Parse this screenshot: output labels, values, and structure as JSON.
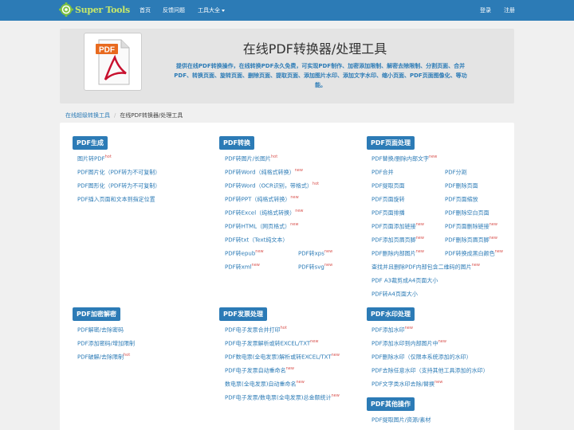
{
  "navbar": {
    "logo_text": "Super Tools",
    "items": [
      "首页",
      "反馈问题",
      "工具大全"
    ],
    "login": "登录",
    "register": "注册",
    "brand_color": "#2c7bb6"
  },
  "hero": {
    "title": "在线PDF转换器/处理工具",
    "desc_line1": "提供在线PDF转换操作，在线转换PDF永久免费，可实现PDF制作、加密添加限制、解密去除限制、分割页面、合并",
    "desc_line2": "PDF、转换页面、旋转页面、删除页面、提取页面、添加图片水印、添加文字水印、缩小页面、PDF页面图像化、等功",
    "desc_line3": "能。",
    "logo_text": "PDF"
  },
  "breadcrumb": {
    "parent": "在线超级转换工具",
    "current": "在线PDF转换器/处理工具"
  },
  "sections": {
    "s1": {
      "title": "PDF生成",
      "links": [
        {
          "t": "图片转PDF",
          "b": "hot"
        },
        {
          "t": "PDF图片化（PDF转为不可复制）",
          "b": ""
        },
        {
          "t": "PDF图形化（PDF转为不可复制）",
          "b": ""
        },
        {
          "t": "PDF插入页面和文本到指定位置",
          "b": ""
        }
      ]
    },
    "s2": {
      "title": "PDF转换",
      "links": [
        {
          "t": "PDF转图片/长图片",
          "b": "hot"
        },
        {
          "t": "PDF转Word（纯格式转换）",
          "b": "new"
        },
        {
          "t": "PDF转Word（OCR识别，带格式）",
          "b": "hot"
        },
        {
          "t": "PDF转PPT（纯格式转换）",
          "b": "new"
        },
        {
          "t": "PDF转Excel（纯格式转换）",
          "b": "new"
        },
        {
          "t": "PDF转HTML（网页格式）",
          "b": "new"
        },
        {
          "t": "PDF转txt（Text纯文本）",
          "b": ""
        },
        {
          "t": "PDF转epub",
          "b": "new"
        },
        {
          "t": "PDF转xps",
          "b": "new"
        },
        {
          "t": "PDF转xml",
          "b": "new"
        },
        {
          "t": "PDF转svg",
          "b": "new"
        }
      ]
    },
    "s3": {
      "title": "PDF页面处理",
      "links": [
        {
          "t": "PDF替换/删除内部文字",
          "b": "new"
        },
        {
          "t": "PDF合并",
          "b": ""
        },
        {
          "t": "PDF分割",
          "b": ""
        },
        {
          "t": "PDF提取页面",
          "b": ""
        },
        {
          "t": "PDF删除页面",
          "b": ""
        },
        {
          "t": "PDF页面旋转",
          "b": ""
        },
        {
          "t": "PDF页面缩放",
          "b": ""
        },
        {
          "t": "PDF页面排播",
          "b": ""
        },
        {
          "t": "PDF删除空白页面",
          "b": ""
        },
        {
          "t": "PDF页面添加链接",
          "b": "new"
        },
        {
          "t": "PDF页面删除链接",
          "b": "new"
        },
        {
          "t": "PDF添加页眉页脚",
          "b": "new"
        },
        {
          "t": "PDF删除页眉页脚",
          "b": "new"
        },
        {
          "t": "PDF删除内部图片",
          "b": "new"
        },
        {
          "t": "PDF转换成黑白颜色",
          "b": "new"
        },
        {
          "t": "查找并且删除PDF内部包含二维码的图片",
          "b": "new"
        },
        {
          "t": "PDF A3裁剪成A4页面大小",
          "b": ""
        },
        {
          "t": "PDF转A4页面大小",
          "b": ""
        }
      ]
    },
    "s4": {
      "title": "PDF加密解密",
      "links": [
        {
          "t": "PDF解密/去除密码",
          "b": ""
        },
        {
          "t": "PDF添加密码/增加限制",
          "b": ""
        },
        {
          "t": "PDF破解/去除限制",
          "b": "hot"
        }
      ]
    },
    "s5": {
      "title": "PDF发票处理",
      "links": [
        {
          "t": "PDF电子发票合并打印",
          "b": "hot"
        },
        {
          "t": "PDF电子发票解析或转EXCEL/TXT",
          "b": "new"
        },
        {
          "t": "PDF数电票(全电发票)解析或转EXCEL/TXT",
          "b": "new"
        },
        {
          "t": "PDF电子发票自动重命名",
          "b": "new"
        },
        {
          "t": "数电票(全电发票)自动重命名",
          "b": "new"
        },
        {
          "t": "PDF电子发票/数电票(全电发票)总金额统计",
          "b": "new"
        }
      ]
    },
    "s6": {
      "title": "PDF水印处理",
      "links": [
        {
          "t": "PDF添加水印",
          "b": "new"
        },
        {
          "t": "PDF添加水印到内部图片中",
          "b": "new"
        },
        {
          "t": "PDF删除水印（仅限本系统添加的水印）",
          "b": ""
        },
        {
          "t": "PDF去除任意水印（支持其他工具添加的水印）",
          "b": ""
        },
        {
          "t": "PDF文字类水印去除/替换",
          "b": "new"
        }
      ]
    },
    "s7": {
      "title": "PDF其他操作",
      "links": [
        {
          "t": "PDF提取图片/资源/素材",
          "b": ""
        }
      ]
    }
  }
}
